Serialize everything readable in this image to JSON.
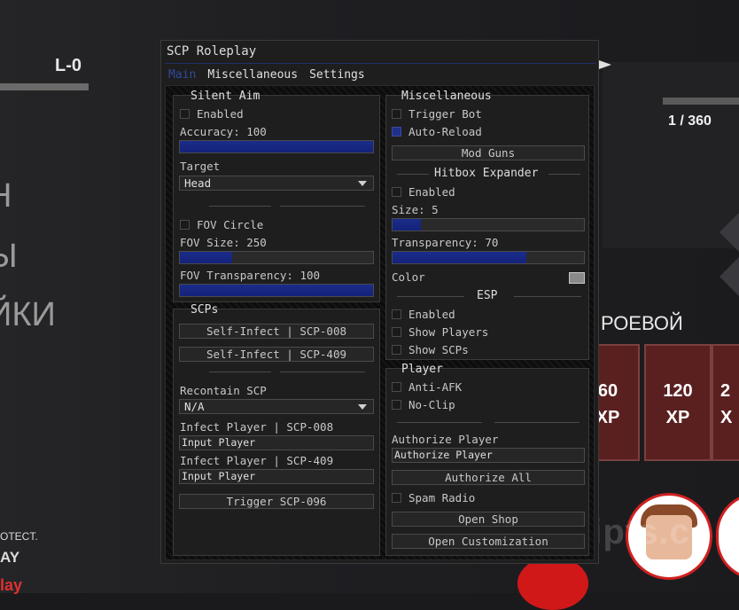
{
  "background": {
    "score": "L-0",
    "menu_items": [
      "Н",
      "Ы",
      "ЙКИ"
    ],
    "small_lines": [
      "OTECT.",
      "AY"
    ],
    "play_label": "lay",
    "counter": "1 / 360",
    "class_title": "РОЕВОЙ",
    "cards": [
      {
        "value": "60",
        "unit": "XP"
      },
      {
        "value": "120",
        "unit": "XP"
      },
      {
        "value": "2",
        "unit": "X"
      }
    ],
    "watermark": "rbxscripts.co"
  },
  "window": {
    "title": "SCP Roleplay",
    "tabs": [
      "Main",
      "Miscellaneous",
      "Settings"
    ],
    "active_tab": "Main",
    "accent_color": "#1f2f8a"
  },
  "silent_aim": {
    "title": "Silent Aim",
    "enabled_label": "Enabled",
    "enabled": false,
    "accuracy_label": "Accuracy: 100",
    "accuracy_fraction": 1.0,
    "target_label": "Target",
    "target_value": "Head",
    "fov_circle_label": "FOV Circle",
    "fov_circle": false,
    "fov_size_label": "FOV Size: 250",
    "fov_size_fraction": 0.27,
    "fov_transparency_label": "FOV Transparency: 100",
    "fov_transparency_fraction": 1.0
  },
  "scps": {
    "title": "SCPs",
    "self_infect_008": "Self-Infect | SCP-008",
    "self_infect_409": "Self-Infect | SCP-409",
    "recontain_label": "Recontain SCP",
    "recontain_value": "N/A",
    "infect_008_label": "Infect Player | SCP-008",
    "infect_008_value": "Input Player",
    "infect_409_label": "Infect Player | SCP-409",
    "infect_409_value": "Input Player",
    "trigger_096": "Trigger SCP-096"
  },
  "misc": {
    "title": "Miscellaneous",
    "trigger_bot_label": "Trigger Bot",
    "trigger_bot": false,
    "auto_reload_label": "Auto-Reload",
    "auto_reload": true,
    "mod_guns": "Mod Guns",
    "hitbox_title": "Hitbox Expander",
    "hitbox_enabled_label": "Enabled",
    "hitbox_enabled": false,
    "size_label": "Size: 5",
    "size_fraction": 0.15,
    "transparency_label": "Transparency: 70",
    "transparency_fraction": 0.7,
    "color_label": "Color",
    "color_value": "#8a8a8a",
    "esp_title": "ESP",
    "esp_enabled_label": "Enabled",
    "esp_enabled": false,
    "show_players_label": "Show Players",
    "show_players": false,
    "show_scps_label": "Show SCPs",
    "show_scps": false
  },
  "player": {
    "title": "Player",
    "anti_afk_label": "Anti-AFK",
    "anti_afk": false,
    "no_clip_label": "No-Clip",
    "no_clip": false,
    "authorize_label": "Authorize Player",
    "authorize_value": "Authorize Player",
    "authorize_all": "Authorize All",
    "spam_radio_label": "Spam Radio",
    "spam_radio": false,
    "open_shop": "Open Shop",
    "open_customization": "Open Customization"
  }
}
